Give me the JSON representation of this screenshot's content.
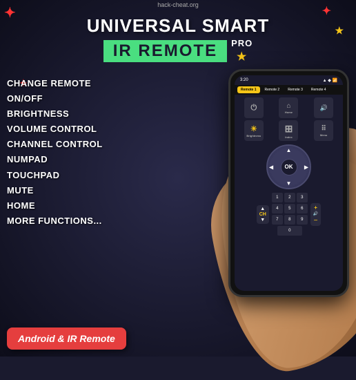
{
  "app": {
    "watermark": "hack-cheat.org",
    "title_line1": "UNIVERSAL SMART",
    "title_ir": "IR REMOTE",
    "title_pro": "PRO"
  },
  "features": {
    "items": [
      "CHANGE REMOTE",
      "ON/OFF",
      "BRIGHTNESS",
      "VOLUME CONTROL",
      "CHANNEL CONTROL",
      "NUMPAD",
      "TOUCHPAD",
      "MUTE",
      "HOME",
      "MORE FUNCTIONS..."
    ]
  },
  "phone": {
    "status_time": "3:20",
    "tabs": [
      "Remote 1",
      "Remote 2",
      "Remote 3",
      "Remote 4"
    ],
    "active_tab": 0,
    "dpad_ok": "OK"
  },
  "badge": {
    "label": "Android & IR Remote"
  },
  "stars": [
    "✦",
    "✦",
    "★",
    "★"
  ],
  "icons": {
    "power": "⏻",
    "home": "⌂",
    "volume": "🔊",
    "brightness": "☀",
    "menu": "⠿",
    "arrow_up": "▲",
    "arrow_down": "▼",
    "arrow_left": "◀",
    "arrow_right": "▶",
    "plus": "+",
    "minus": "−"
  }
}
